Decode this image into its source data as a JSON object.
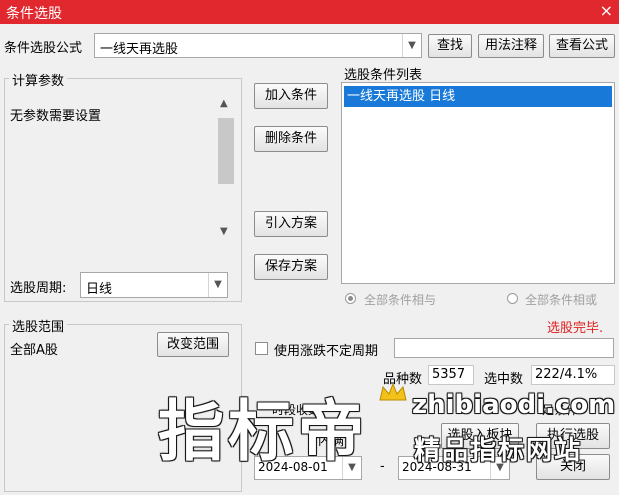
{
  "window": {
    "title": "条件选股",
    "close_glyph": "×"
  },
  "formula": {
    "label": "条件选股公式",
    "value": "一线天再选股",
    "find_button": "查找",
    "usage_button": "用法注释",
    "view_button": "查看公式"
  },
  "params": {
    "legend": "计算参数",
    "message": "无参数需要设置",
    "period_label": "选股周期:",
    "period_value": "日线"
  },
  "actions": {
    "add": "加入条件",
    "delete": "删除条件",
    "import": "引入方案",
    "save": "保存方案"
  },
  "conditions": {
    "title": "选股条件列表",
    "items": [
      "一线天再选股  日线"
    ],
    "radio_and": "全部条件相与",
    "radio_or": "全部条件相或",
    "status": "选股完毕."
  },
  "scope": {
    "legend": "选股范围",
    "value": "全部A股",
    "change_button": "改变范围"
  },
  "options": {
    "variable_period_label": "使用涨跌不定周期"
  },
  "stats": {
    "count_label": "品种数",
    "count_value": "5357",
    "selected_label": "选中数",
    "selected_value": "222/4.1%"
  },
  "bottom": {
    "partial_label_1": "时段收数",
    "partial_label_2": "内满",
    "partial_label_3": "足条件",
    "date_from": "2024-08-01",
    "date_sep": "-",
    "date_to": "2024-08-31",
    "to_block_button": "选股入板块",
    "run_button": "执行选股",
    "close_button": "关闭"
  },
  "watermark": {
    "big_text": "指标帝",
    "url_text": "zhibiaodi.com",
    "site_text": "精品指标网站"
  },
  "colors": {
    "title_bar": "#e0282e",
    "selection": "#1979d8",
    "status_red": "#e02020"
  }
}
